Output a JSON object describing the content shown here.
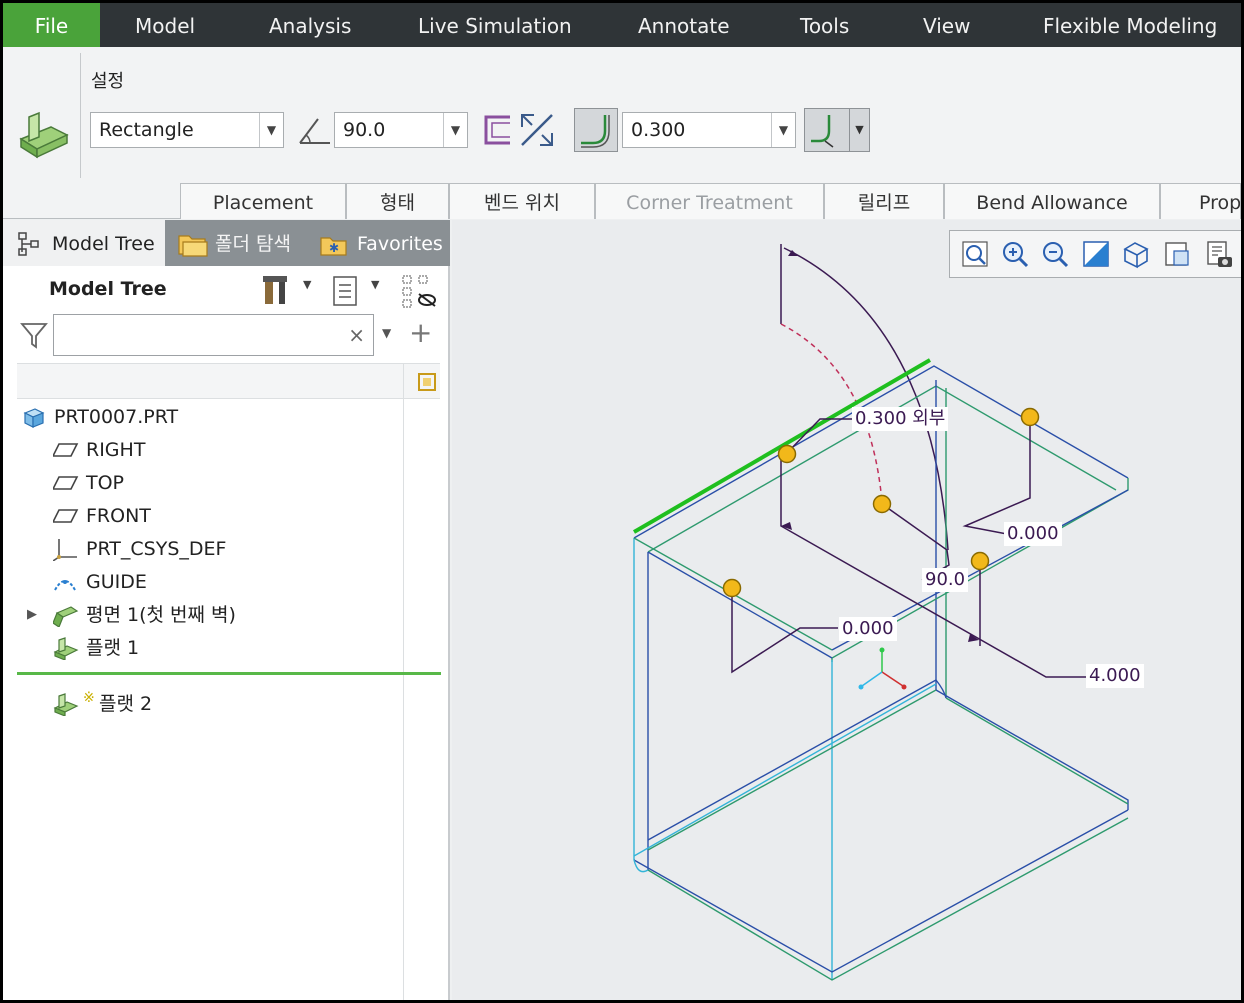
{
  "menubar": {
    "file": "File",
    "tabs": [
      "Model",
      "Analysis",
      "Live Simulation",
      "Annotate",
      "Tools",
      "View",
      "Flexible Modeling"
    ]
  },
  "ribbon": {
    "group_label": "설정",
    "shape_dropdown": "Rectangle",
    "angle_value": "90.0",
    "radius_value": "0.300",
    "sub_tabs": [
      "Placement",
      "형태",
      "벤드 위치",
      "Corner Treatment",
      "릴리프",
      "Bend Allowance",
      "Prop"
    ]
  },
  "left_panel": {
    "tabs": [
      "Model Tree",
      "폴더 탐색",
      "Favorites"
    ],
    "header": "Model Tree",
    "search_value": "",
    "items": [
      "PRT0007.PRT",
      "RIGHT",
      "TOP",
      "FRONT",
      "PRT_CSYS_DEF",
      "GUIDE",
      "평면 1(첫 번째 벽)",
      "플랫 1"
    ],
    "new_item_marker": "※",
    "new_item": "플랫 2"
  },
  "graphics": {
    "dimensions": {
      "radius": "0.300 외부",
      "offset_top": "0.000",
      "angle": "90.0",
      "offset_left": "0.000",
      "length": "4.000"
    }
  },
  "colors": {
    "file_tab": "#4aa33a",
    "selected_edge": "#1fbf1f",
    "model_edge_blue": "#2a4fa8",
    "model_edge_green": "#2e9a6e",
    "model_edge_cyan": "#33b4d8",
    "dimension_line": "#3b1a52",
    "drag_handle": "#f2b81a"
  }
}
